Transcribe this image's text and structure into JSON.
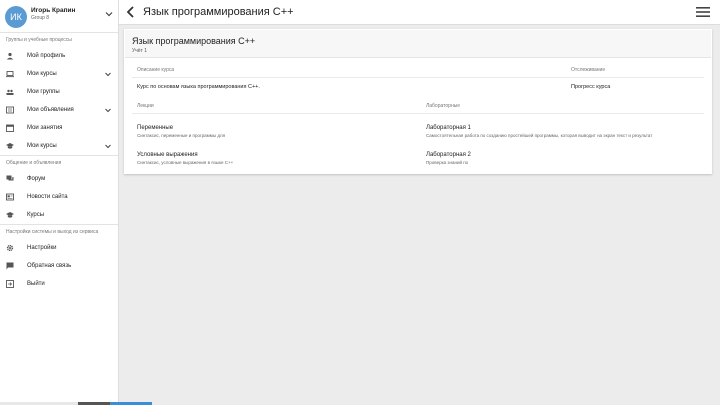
{
  "user": {
    "initials": "ИК",
    "name": "Игорь Крапин",
    "group": "Group 8"
  },
  "sidebar": {
    "section1_title": "Группы и учебные процессы",
    "section2_title": "Общение и объявления",
    "section3_title": "Настройки системы и выход из сервиса",
    "items1": [
      {
        "label": "Мой профиль"
      },
      {
        "label": "Мои курсы"
      },
      {
        "label": "Мои группы"
      },
      {
        "label": "Мои объявления"
      },
      {
        "label": "Мои занятия"
      },
      {
        "label": "Мои курсы"
      }
    ],
    "items2": [
      {
        "label": "Форум"
      },
      {
        "label": "Новости сайта"
      },
      {
        "label": "Курсы"
      }
    ],
    "items3": [
      {
        "label": "Настройки"
      },
      {
        "label": "Обратная связь"
      },
      {
        "label": "Выйти"
      }
    ]
  },
  "topbar": {
    "title": "Язык программирования C++"
  },
  "course": {
    "name": "Язык программирования C++",
    "subtitle": "Учёт 1",
    "label_description": "Описание курса",
    "label_status": "Отслеживание",
    "description": "Курс по основам языка программирования С++.",
    "status": "Прогресс курса",
    "label_lectures": "Лекции",
    "label_labs": "Лабораторные",
    "lectures": [
      {
        "title": "Переменные",
        "desc": "Синтаксис, переменные и программы для"
      },
      {
        "title": "Условные выражения",
        "desc": "Синтаксис, условные выражения в языке С++"
      }
    ],
    "labs": [
      {
        "title": "Лабораторная 1",
        "desc": "Самостоятельная работа по созданию простейшей программы, которая выводит на экран текст и результат"
      },
      {
        "title": "Лабораторная 2",
        "desc": "Проверка знаний по"
      }
    ]
  },
  "colors": {
    "avatar": "#5a9bd4",
    "background": "#ececec",
    "card": "#ffffff"
  }
}
